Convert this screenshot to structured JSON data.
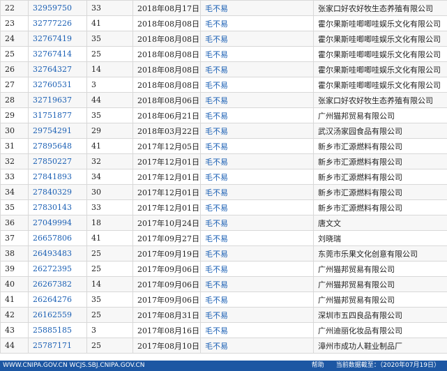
{
  "records": [
    {
      "seq": "22",
      "reg_no": "32959750",
      "class": "33",
      "date": "2018年08月17日",
      "agent": "毛不易",
      "applicant": "张家口好农好牧生态养殖有限公司"
    },
    {
      "seq": "23",
      "reg_no": "32777226",
      "class": "41",
      "date": "2018年08月08日",
      "agent": "毛不易",
      "applicant": "霍尔果斯哇唧唧哇娱乐文化有限公司"
    },
    {
      "seq": "24",
      "reg_no": "32767419",
      "class": "35",
      "date": "2018年08月08日",
      "agent": "毛不易",
      "applicant": "霍尔果斯哇唧唧哇娱乐文化有限公司"
    },
    {
      "seq": "25",
      "reg_no": "32767414",
      "class": "25",
      "date": "2018年08月08日",
      "agent": "毛不易",
      "applicant": "霍尔果斯哇唧唧哇娱乐文化有限公司"
    },
    {
      "seq": "26",
      "reg_no": "32764327",
      "class": "14",
      "date": "2018年08月08日",
      "agent": "毛不易",
      "applicant": "霍尔果斯哇唧唧哇娱乐文化有限公司"
    },
    {
      "seq": "27",
      "reg_no": "32760531",
      "class": "3",
      "date": "2018年08月08日",
      "agent": "毛不易",
      "applicant": "霍尔果斯哇唧唧哇娱乐文化有限公司"
    },
    {
      "seq": "28",
      "reg_no": "32719637",
      "class": "44",
      "date": "2018年08月06日",
      "agent": "毛不易",
      "applicant": "张家口好农好牧生态养殖有限公司"
    },
    {
      "seq": "29",
      "reg_no": "31751877",
      "class": "35",
      "date": "2018年06月21日",
      "agent": "毛不易",
      "applicant": "广州猫邦贸易有限公司"
    },
    {
      "seq": "30",
      "reg_no": "29754291",
      "class": "29",
      "date": "2018年03月22日",
      "agent": "毛不易",
      "applicant": "武汉汤家园食品有限公司"
    },
    {
      "seq": "31",
      "reg_no": "27895648",
      "class": "41",
      "date": "2017年12月05日",
      "agent": "毛不易",
      "applicant": "新乡市汇源燃料有限公司"
    },
    {
      "seq": "32",
      "reg_no": "27850227",
      "class": "32",
      "date": "2017年12月01日",
      "agent": "毛不易",
      "applicant": "新乡市汇源燃料有限公司"
    },
    {
      "seq": "33",
      "reg_no": "27841893",
      "class": "34",
      "date": "2017年12月01日",
      "agent": "毛不易",
      "applicant": "新乡市汇源燃料有限公司"
    },
    {
      "seq": "34",
      "reg_no": "27840329",
      "class": "30",
      "date": "2017年12月01日",
      "agent": "毛不易",
      "applicant": "新乡市汇源燃料有限公司"
    },
    {
      "seq": "35",
      "reg_no": "27830143",
      "class": "33",
      "date": "2017年12月01日",
      "agent": "毛不易",
      "applicant": "新乡市汇源燃料有限公司"
    },
    {
      "seq": "36",
      "reg_no": "27049994",
      "class": "18",
      "date": "2017年10月24日",
      "agent": "毛不易",
      "applicant": "唐文文"
    },
    {
      "seq": "37",
      "reg_no": "26657806",
      "class": "41",
      "date": "2017年09月27日",
      "agent": "毛不易",
      "applicant": "刘晓瑞"
    },
    {
      "seq": "38",
      "reg_no": "26493483",
      "class": "25",
      "date": "2017年09月19日",
      "agent": "毛不易",
      "applicant": "东莞市乐果文化创意有限公司"
    },
    {
      "seq": "39",
      "reg_no": "26272395",
      "class": "25",
      "date": "2017年09月06日",
      "agent": "毛不易",
      "applicant": "广州猫邦贸易有限公司"
    },
    {
      "seq": "40",
      "reg_no": "26267382",
      "class": "14",
      "date": "2017年09月06日",
      "agent": "毛不易",
      "applicant": "广州猫邦贸易有限公司"
    },
    {
      "seq": "41",
      "reg_no": "26264276",
      "class": "35",
      "date": "2017年09月06日",
      "agent": "毛不易",
      "applicant": "广州猫邦贸易有限公司"
    },
    {
      "seq": "42",
      "reg_no": "26162559",
      "class": "25",
      "date": "2017年08月31日",
      "agent": "毛不易",
      "applicant": "深圳市五四良品有限公司"
    },
    {
      "seq": "43",
      "reg_no": "25885185",
      "class": "3",
      "date": "2017年08月16日",
      "agent": "毛不易",
      "applicant": "广州迪丽化妆品有限公司"
    },
    {
      "seq": "44",
      "reg_no": "25787171",
      "class": "25",
      "date": "2017年08月10日",
      "agent": "毛不易",
      "applicant": "漳州市成功人鞋业制品厂"
    }
  ],
  "footer": {
    "sites": "WWW.CNIPA.GOV.CN WCJS.SBJ.CNIPA.GOV.CN",
    "help": "帮助",
    "data_deadline": "当前数据截至：（2020年07月19日）"
  },
  "colors": {
    "link": "#1a5fb4",
    "footer_bg": "#1d57a3",
    "row_alt": "#f7f7f7",
    "border": "#d8d8d8"
  }
}
